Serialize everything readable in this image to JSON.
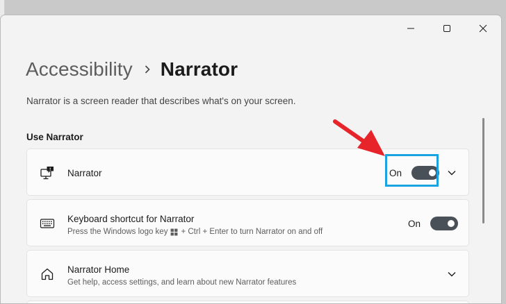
{
  "breadcrumb": {
    "parent": "Accessibility",
    "current": "Narrator"
  },
  "description": "Narrator is a screen reader that describes what's on your screen.",
  "section_title": "Use Narrator",
  "cards": [
    {
      "title": "Narrator",
      "state": "On",
      "icon": "narrator-monitor-icon",
      "toggle_on": true,
      "expandable": true
    },
    {
      "title": "Keyboard shortcut for Narrator",
      "subtitle_pre": "Press the Windows logo key",
      "subtitle_post": "+ Ctrl + Enter to turn Narrator on and off",
      "state": "On",
      "icon": "keyboard-icon",
      "toggle_on": true
    },
    {
      "title": "Narrator Home",
      "subtitle": "Get help, access settings, and learn about new Narrator features",
      "icon": "home-icon",
      "expandable": true
    }
  ],
  "colors": {
    "toggle_on": "#4a5058",
    "highlight_box": "#1aa3e0",
    "annotation_arrow": "#e8242b"
  }
}
